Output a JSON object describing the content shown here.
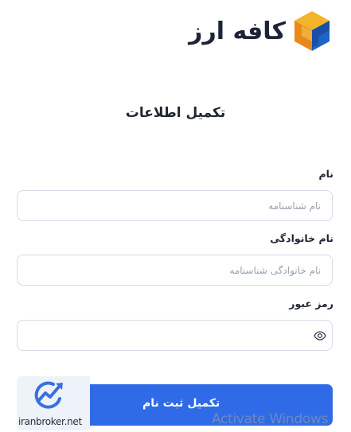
{
  "brand": {
    "name": "کافه ارز"
  },
  "page": {
    "title": "تکمیل اطلاعات"
  },
  "form": {
    "first_name": {
      "label": "نام",
      "placeholder": "نام شناسنامه",
      "value": ""
    },
    "last_name": {
      "label": "نام خانوادگی",
      "placeholder": "نام خانوادگی شناسنامه",
      "value": ""
    },
    "password": {
      "label": "رمز عبور",
      "placeholder": "",
      "value": ""
    },
    "submit_label": "تکمیل ثبت نام"
  },
  "overlays": {
    "watermark_text": "iranbroker.net",
    "os_notice": "Activate Windows"
  },
  "colors": {
    "primary": "#2f6be6",
    "logo_orange": "#f0a41d",
    "logo_blue": "#1e63c7",
    "input_border": "#d6dbe6"
  },
  "icons": {
    "password_toggle": "eye-icon"
  }
}
